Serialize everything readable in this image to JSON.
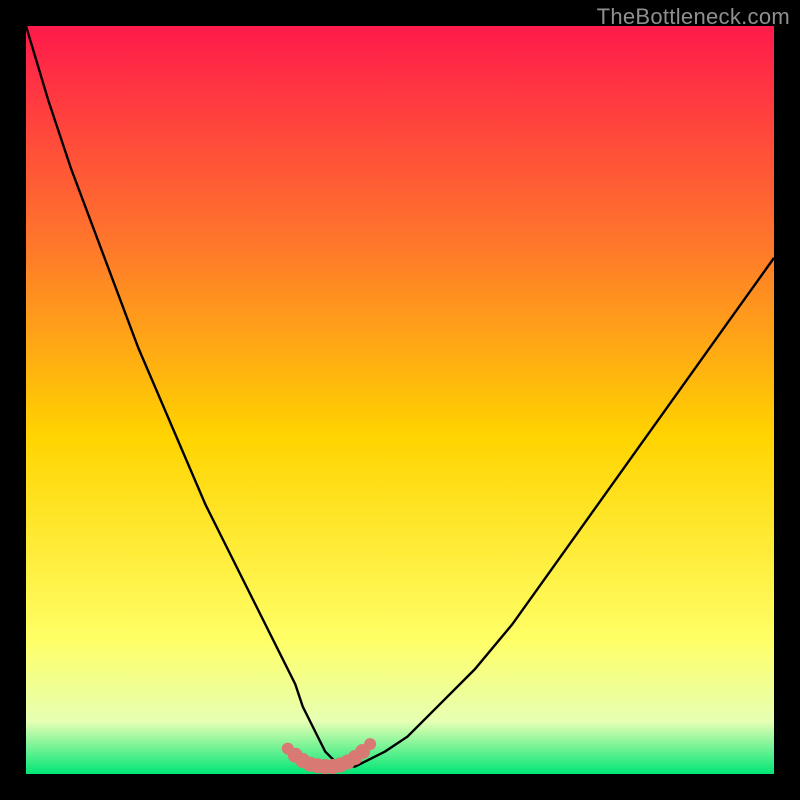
{
  "watermark": "TheBottleneck.com",
  "colors": {
    "page_bg": "#000000",
    "gradient_top": "#ff1a4b",
    "gradient_mid1": "#ff7a2a",
    "gradient_mid2": "#ffd400",
    "gradient_mid3": "#ffff66",
    "gradient_low": "#e6ffb3",
    "gradient_bottom": "#00e676",
    "curve": "#000000",
    "marker": "#d87a73"
  },
  "chart_data": {
    "type": "line",
    "title": "",
    "xlabel": "",
    "ylabel": "",
    "xlim": [
      0,
      100
    ],
    "ylim": [
      0,
      100
    ],
    "grid": false,
    "annotations": [
      "TheBottleneck.com"
    ],
    "series": [
      {
        "name": "bottleneck-curve",
        "x": [
          0,
          3,
          6,
          9,
          12,
          15,
          18,
          21,
          24,
          27,
          30,
          32,
          34,
          36,
          37,
          38,
          39,
          40,
          41,
          42,
          43,
          44,
          46,
          48,
          51,
          55,
          60,
          65,
          70,
          75,
          80,
          85,
          90,
          95,
          100
        ],
        "y": [
          100,
          90,
          81,
          73,
          65,
          57,
          50,
          43,
          36,
          30,
          24,
          20,
          16,
          12,
          9,
          7,
          5,
          3,
          2,
          1,
          1,
          1,
          2,
          3,
          5,
          9,
          14,
          20,
          27,
          34,
          41,
          48,
          55,
          62,
          69
        ]
      }
    ],
    "markers": {
      "name": "sweet-spot-markers",
      "x": [
        35,
        36,
        37,
        38,
        39,
        40,
        41,
        42,
        43,
        44,
        45,
        46
      ],
      "y": [
        3.4,
        2.5,
        1.8,
        1.3,
        1.1,
        1.0,
        1.0,
        1.2,
        1.6,
        2.2,
        3.0,
        4.0
      ]
    }
  }
}
